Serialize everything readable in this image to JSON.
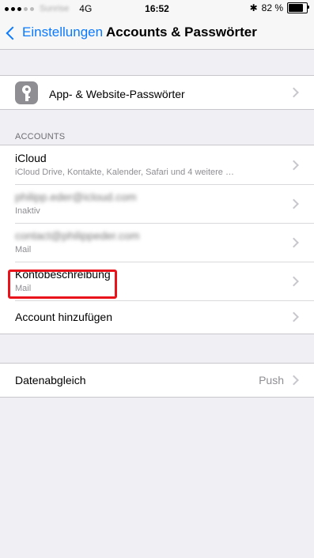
{
  "status_bar": {
    "carrier": "Sunrise",
    "network": "4G",
    "time": "16:52",
    "bluetooth": "✱",
    "battery_percent": "82 %",
    "battery_level": 0.82
  },
  "nav": {
    "back_label": "Einstellungen",
    "title": "Accounts & Passwörter"
  },
  "passwords": {
    "label": "App- & Website-Passwörter",
    "icon": "key-icon"
  },
  "accounts_section": {
    "header": "ACCOUNTS",
    "items": [
      {
        "title": "iCloud",
        "subtitle": "iCloud Drive, Kontakte, Kalender, Safari und 4 weitere …"
      },
      {
        "title": "philipp.eder@icloud.com",
        "subtitle": "Inaktiv"
      },
      {
        "title": "contact@philippeder.com",
        "subtitle": "Mail"
      },
      {
        "title": "Kontobeschreibung",
        "subtitle": "Mail"
      }
    ],
    "add_label": "Account hinzufügen"
  },
  "fetch": {
    "label": "Datenabgleich",
    "value": "Push"
  },
  "colors": {
    "accent": "#0a7aff",
    "highlight": "#e8131b",
    "background": "#efeff4"
  }
}
